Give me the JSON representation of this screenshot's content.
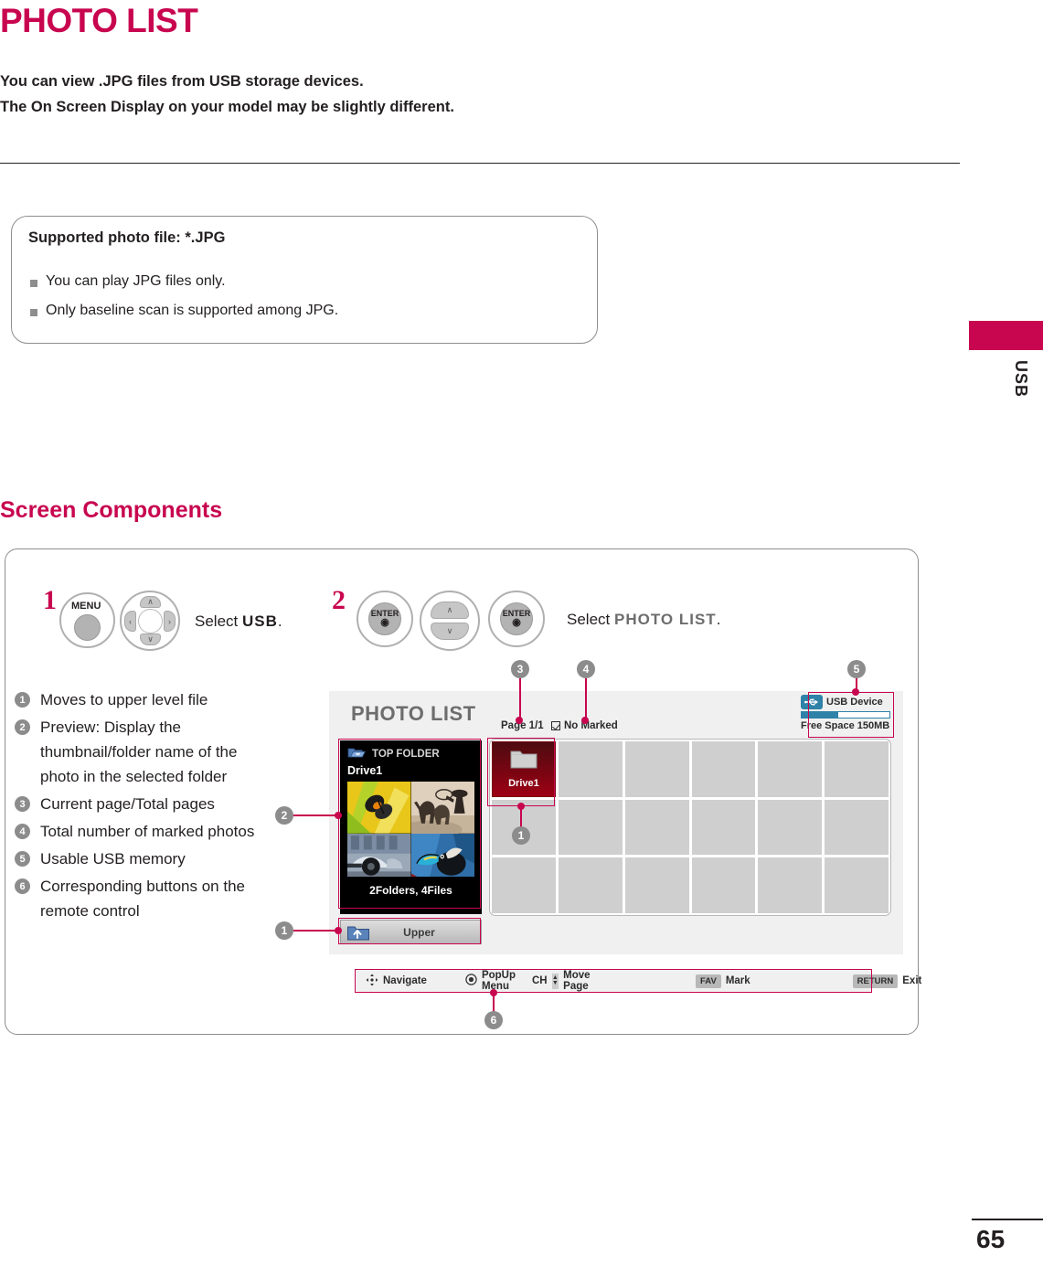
{
  "page": {
    "title": "PHOTO LIST",
    "intro_lines": [
      "You can view .JPG files from USB storage devices.",
      "The On Screen Display on your model may be slightly different."
    ],
    "side_tab_label": "USB",
    "page_number": "65",
    "accent_color": "#c8054f",
    "gray_bullet_color": "#8c8c8c"
  },
  "support_box": {
    "title": "Supported photo file: *.JPG",
    "items": [
      "You can play JPG files only.",
      "Only baseline scan is supported among JPG."
    ]
  },
  "section": {
    "heading": "Screen Components"
  },
  "steps": [
    {
      "number": "1",
      "buttons": [
        "MENU",
        "dpad"
      ],
      "instruction_prefix": "Select ",
      "instruction_target": "USB",
      "instruction_suffix": "."
    },
    {
      "number": "2",
      "buttons": [
        "ENTER",
        "updown",
        "ENTER"
      ],
      "instruction_prefix": "Select ",
      "instruction_target": "PHOTO LIST",
      "instruction_suffix": "."
    }
  ],
  "remote": {
    "menu_label": "MENU",
    "enter_label": "ENTER",
    "up_glyph": "∧",
    "down_glyph": "∨",
    "left_glyph": "‹",
    "right_glyph": "›"
  },
  "legend": [
    {
      "num": "1",
      "text": "Moves to upper level file"
    },
    {
      "num": "2",
      "text": "Preview: Display the thumbnail/folder name of the photo in the selected folder"
    },
    {
      "num": "3",
      "text": "Current page/Total pages"
    },
    {
      "num": "4",
      "text": "Total number of marked photos"
    },
    {
      "num": "5",
      "text": "Usable USB memory"
    },
    {
      "num": "6",
      "text": "Corresponding buttons on the remote control"
    }
  ],
  "osd": {
    "title": "PHOTO LIST",
    "page_indicator": "Page 1/1",
    "marked_status": "No Marked",
    "usb": {
      "device_label": "USB Device",
      "free_space": "Free Space 150MB",
      "bar_fill_percent": 42,
      "icon": "usb-icon",
      "bar_color": "#2e82a8"
    },
    "preview": {
      "header": "TOP FOLDER",
      "folder_name": "Drive1",
      "count_text": "2Folders, 4Files",
      "folder_icon": "open-folder-icon",
      "thumbnails": [
        "butterfly-photo",
        "cowboy-photo",
        "racecar-photo",
        "toucan-photo"
      ]
    },
    "upper_button": {
      "label": "Upper",
      "icon": "folder-up-icon"
    },
    "grid": {
      "columns": 6,
      "rows": 3,
      "selected_index": 0,
      "selected_name": "Drive1",
      "selected_icon": "folder-icon"
    },
    "navbar": [
      {
        "key": "navigate-dpad-icon",
        "key_type": "icon",
        "label": "Navigate"
      },
      {
        "key": "enter-circle-icon",
        "key_type": "icon",
        "label": "PopUp Menu"
      },
      {
        "key": "CH",
        "key_type": "ch",
        "label": "Move Page"
      },
      {
        "key": "FAV",
        "key_type": "box",
        "label": "Mark"
      },
      {
        "key": "RETURN",
        "key_type": "box",
        "label": "Exit"
      }
    ]
  },
  "callouts": [
    {
      "num": "1"
    },
    {
      "num": "2"
    },
    {
      "num": "3"
    },
    {
      "num": "4"
    },
    {
      "num": "5"
    },
    {
      "num": "6"
    }
  ]
}
